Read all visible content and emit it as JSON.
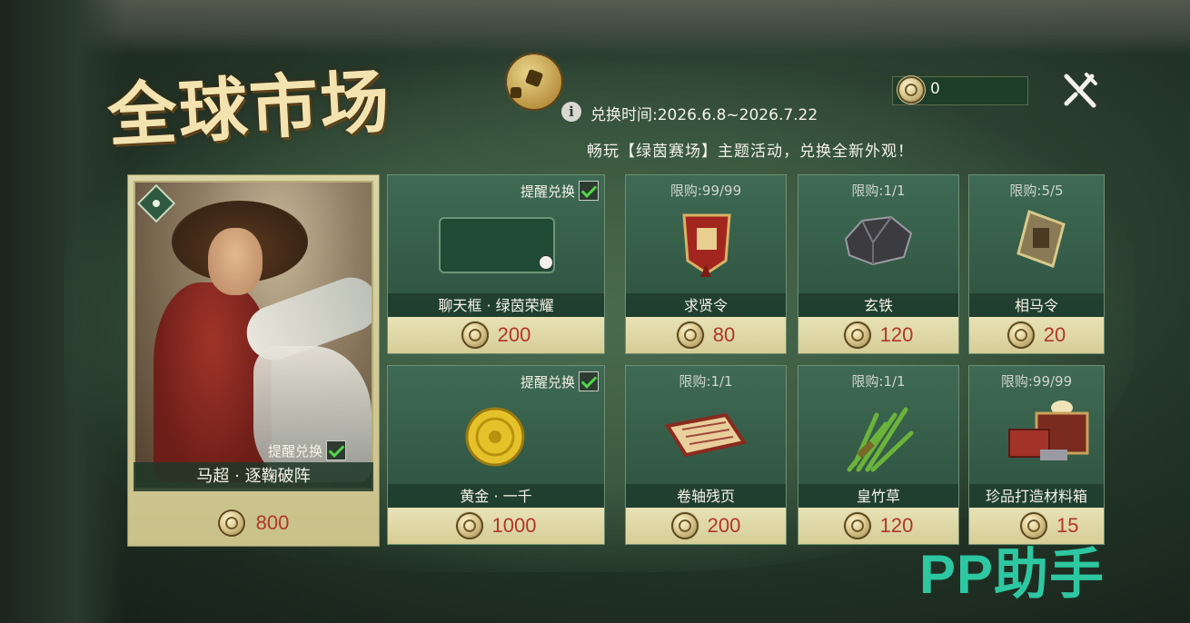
{
  "header": {
    "title": "全球市场",
    "exchange_time": "兑换时间:2026.6.8~2026.7.22",
    "activity_desc": "畅玩【绿茵赛场】主题活动，兑换全新外观！",
    "currency_value": "0"
  },
  "hero": {
    "name": "马超 · 逐鞠破阵",
    "price": "800",
    "remind_label": "提醒兑换"
  },
  "items": [
    {
      "name": "聊天框 · 绿茵荣耀",
      "price": "200",
      "remind_label": "提醒兑换",
      "icon": "chat-frame-icon"
    },
    {
      "name": "求贤令",
      "price": "80",
      "limit": "限购:99/99",
      "icon": "recruit-token-icon"
    },
    {
      "name": "玄铁",
      "price": "120",
      "limit": "限购:1/1",
      "icon": "black-iron-icon"
    },
    {
      "name": "相马令",
      "price": "20",
      "limit": "限购:5/5",
      "icon": "horse-token-icon"
    },
    {
      "name": "黄金 · 一千",
      "price": "1000",
      "remind_label": "提醒兑换",
      "icon": "gold-coin-icon"
    },
    {
      "name": "卷轴残页",
      "price": "200",
      "limit": "限购:1/1",
      "icon": "scroll-icon"
    },
    {
      "name": "皇竹草",
      "price": "120",
      "limit": "限购:1/1",
      "icon": "grass-icon"
    },
    {
      "name": "珍品打造材料箱",
      "price": "15",
      "limit": "限购:99/99",
      "icon": "material-chest-icon"
    }
  ],
  "watermark": "PP助手",
  "colors": {
    "price": "#b0362a",
    "check": "#53d54b",
    "watermark": "#2ed0a8"
  }
}
